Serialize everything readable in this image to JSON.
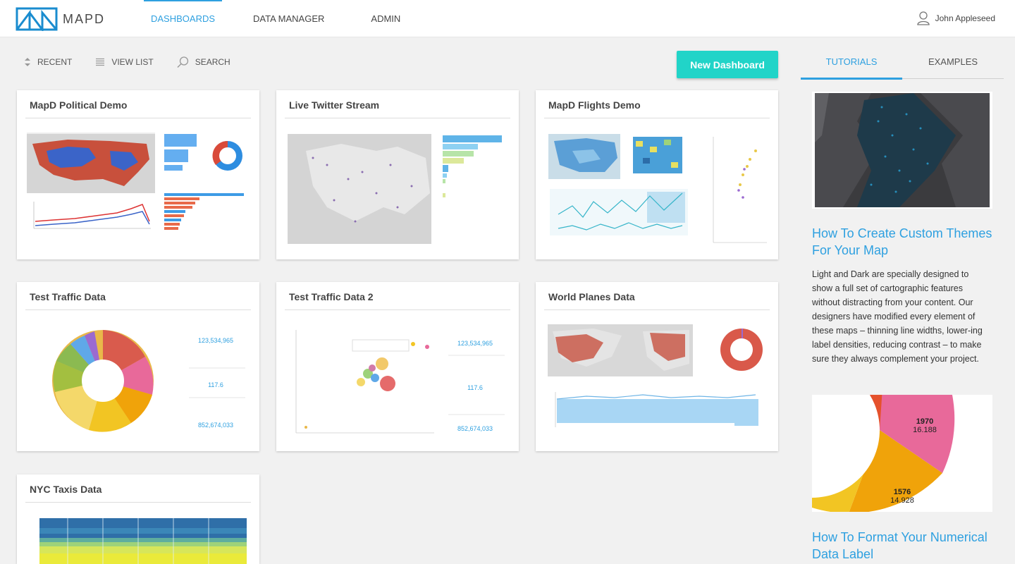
{
  "app": {
    "logo_text": "MAPD",
    "nav": [
      "DASHBOARDS",
      "DATA MANAGER",
      "ADMIN"
    ],
    "user_name": "John Appleseed"
  },
  "toolbar": {
    "recent": "RECENT",
    "view_list": "VIEW LIST",
    "search": "SEARCH",
    "new_dashboard": "New Dashboard"
  },
  "dashboards": [
    {
      "title": "MapD Political Demo"
    },
    {
      "title": "Live Twitter Stream"
    },
    {
      "title": "MapD Flights Demo"
    },
    {
      "title": "Test Traffic Data"
    },
    {
      "title": "Test Traffic Data 2"
    },
    {
      "title": "World Planes Data"
    },
    {
      "title": "NYC Taxis Data"
    }
  ],
  "thumb_values": {
    "count": "123,534,965",
    "avg": "117.6",
    "total": "852,674,033"
  },
  "panel": {
    "tabs": [
      "TUTORIALS",
      "EXAMPLES"
    ],
    "tutorials": [
      {
        "title": "How To Create Custom Themes For Your Map",
        "text": "Light and Dark are specially designed to show a full set of cartographic features without distracting from your content. Our designers have modified every element of these maps – thinning line widths, lower-ing label densities, reducing contrast – to make sure they always complement your project."
      },
      {
        "title": "How To Format Your Numerical Data Label",
        "labels": [
          {
            "key": "1970",
            "value": "16.188"
          },
          {
            "key": "1576",
            "value": "14.928"
          }
        ]
      }
    ]
  },
  "colors": {
    "accent": "#2ea0e0",
    "button": "#21d4c8",
    "pink": "#e8699a",
    "orange": "#f0a30a",
    "yellow": "#f2c523",
    "red": "#e5512c"
  }
}
